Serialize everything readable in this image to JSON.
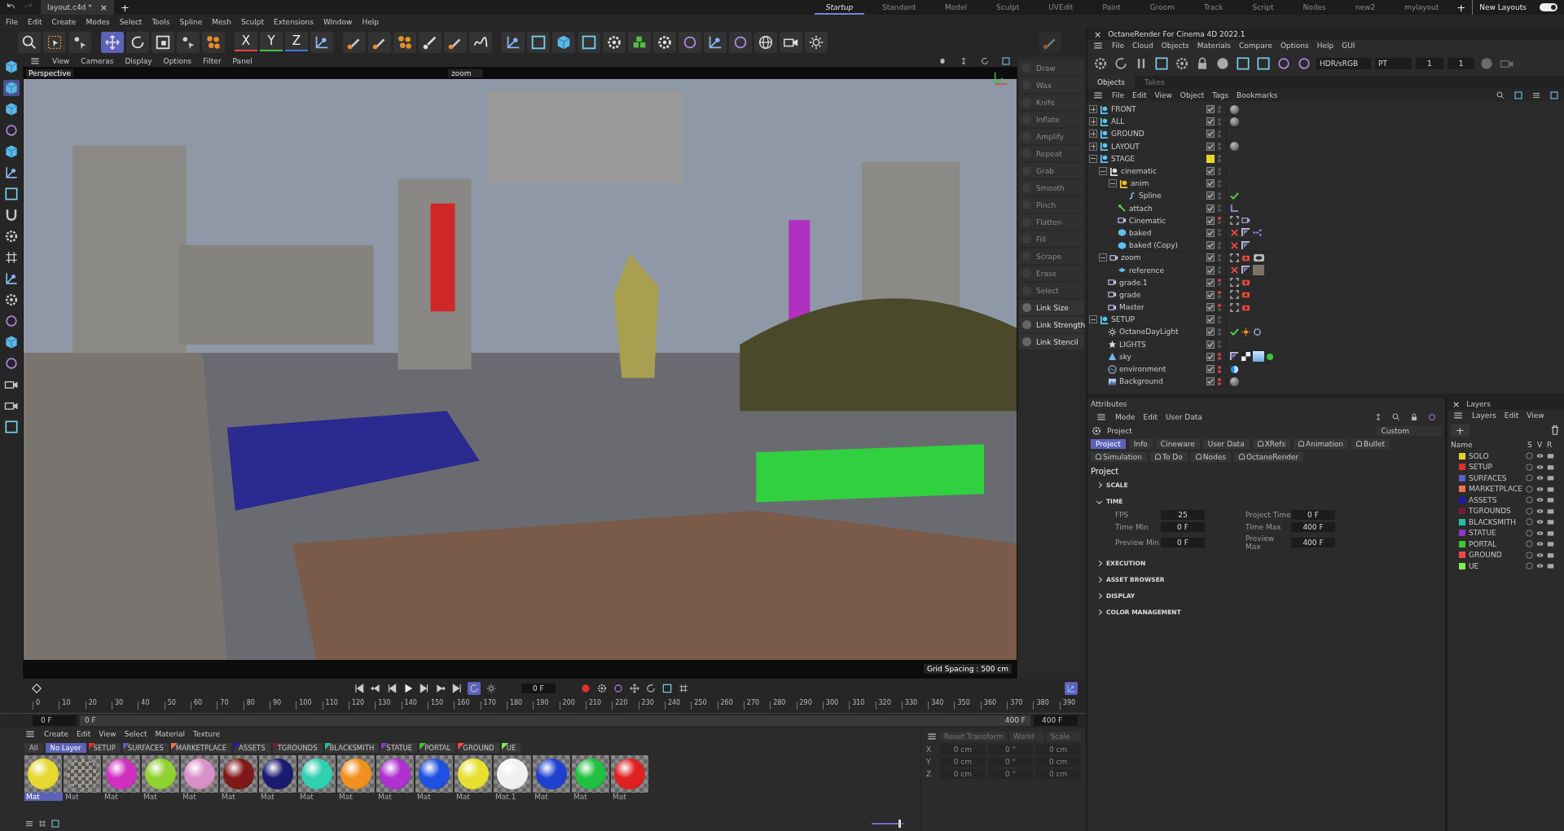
{
  "title_bar": {
    "file_tab": "layout.c4d *",
    "close": "×",
    "new_tab": "+",
    "workspaces": [
      {
        "label": "Startup",
        "selected": true
      },
      {
        "label": "Standard",
        "selected": false
      },
      {
        "label": "Model",
        "selected": false
      },
      {
        "label": "Sculpt",
        "selected": false
      },
      {
        "label": "UVEdit",
        "selected": false
      },
      {
        "label": "Paint",
        "selected": false
      },
      {
        "label": "Groom",
        "selected": false
      },
      {
        "label": "Track",
        "selected": false
      },
      {
        "label": "Script",
        "selected": false
      },
      {
        "label": "Nodes",
        "selected": false
      },
      {
        "label": "new2",
        "selected": false
      },
      {
        "label": "mylayout",
        "selected": false
      }
    ],
    "add_layout": "+",
    "new_layouts": {
      "label": "New Layouts",
      "on": true
    }
  },
  "menu_bar": [
    "File",
    "Edit",
    "Create",
    "Modes",
    "Select",
    "Tools",
    "Spline",
    "Mesh",
    "Sculpt",
    "Extensions",
    "Window",
    "Help"
  ],
  "axis_buttons": [
    {
      "label": "X",
      "color": "#e04848"
    },
    {
      "label": "Y",
      "color": "#48c048"
    },
    {
      "label": "Z",
      "color": "#4878e0"
    }
  ],
  "viewport": {
    "menu": [
      "View",
      "Cameras",
      "Display",
      "Options",
      "Filter",
      "Panel"
    ],
    "camera": "Perspective",
    "active_camera": "zoom",
    "grid_spacing": "Grid Spacing : 500 cm"
  },
  "sculpt_tools": [
    {
      "label": "Draw",
      "disabled": true
    },
    {
      "label": "Wax",
      "disabled": true
    },
    {
      "label": "Knife",
      "disabled": true
    },
    {
      "label": "Inflate",
      "disabled": true
    },
    {
      "label": "Amplify",
      "disabled": true
    },
    {
      "label": "Repeat",
      "disabled": true
    },
    {
      "label": "Grab",
      "disabled": true
    },
    {
      "label": "Smooth",
      "disabled": true
    },
    {
      "label": "Pinch",
      "disabled": true
    },
    {
      "label": "Flatten",
      "disabled": true
    },
    {
      "label": "Fill",
      "disabled": true
    },
    {
      "label": "Scrape",
      "disabled": true
    },
    {
      "label": "Erase",
      "disabled": true
    },
    {
      "label": "Select",
      "disabled": true
    },
    {
      "label": "Link Size",
      "disabled": false
    },
    {
      "label": "Link Strength",
      "disabled": false
    },
    {
      "label": "Link Stencil",
      "disabled": false
    }
  ],
  "octane": {
    "title": "OctaneRender For Cinema 4D 2022.1",
    "close": "×",
    "menu": [
      "File",
      "Cloud",
      "Objects",
      "Materials",
      "Compare",
      "Options",
      "Help",
      "GUI"
    ],
    "color_space": "HDR/sRGB",
    "kernel": "PT",
    "field_1": "1",
    "field_2": "1"
  },
  "objects": {
    "tabs": [
      {
        "label": "Objects",
        "selected": true
      },
      {
        "label": "Takes",
        "selected": false
      }
    ],
    "menu": [
      "File",
      "Edit",
      "View",
      "Object",
      "Tags",
      "Bookmarks"
    ],
    "tree": [
      {
        "name": "FRONT",
        "kind": "layer-null",
        "expanded": false,
        "enabled": true,
        "editor_off": false,
        "render_off": false,
        "tags": [
          {
            "kind": "material"
          }
        ]
      },
      {
        "name": "ALL",
        "kind": "layer-null",
        "expanded": false,
        "enabled": true,
        "editor_off": false,
        "render_off": false,
        "tags": [
          {
            "kind": "material"
          }
        ]
      },
      {
        "name": "GROUND",
        "kind": "layer-null",
        "expanded": false,
        "enabled": true,
        "editor_off": false,
        "render_off": false
      },
      {
        "name": "LAYOUT",
        "kind": "layer-null",
        "expanded": false,
        "enabled": true,
        "editor_off": false,
        "render_off": false,
        "tags": [
          {
            "kind": "material"
          }
        ]
      },
      {
        "name": "STAGE",
        "kind": "layer-null",
        "expanded": true,
        "color": "#e8d82a",
        "editor_off": false,
        "render_off": false,
        "children": [
          {
            "name": "cinematic",
            "kind": "null",
            "expanded": true,
            "enabled": true,
            "editor_off": false,
            "render_off": false,
            "children": [
              {
                "name": "anim",
                "kind": "null-yellow",
                "expanded": true,
                "enabled": true,
                "editor_off": false,
                "render_off": false,
                "children": [
                  {
                    "name": "Spline",
                    "kind": "spline",
                    "enabled": true,
                    "editor_off": false,
                    "render_off": false,
                    "tags": [
                      {
                        "kind": "check"
                      }
                    ]
                  }
                ]
              },
              {
                "name": "attach",
                "kind": "connector",
                "enabled": true,
                "editor_off": false,
                "render_off": false,
                "tags": [
                  {
                    "kind": "joint"
                  }
                ]
              },
              {
                "name": "Cinematic",
                "kind": "camera",
                "enabled": true,
                "editor_off": true,
                "render_off": false,
                "tags": [
                  {
                    "kind": "target"
                  },
                  {
                    "kind": "camera"
                  }
                ]
              },
              {
                "name": "baked",
                "kind": "cube",
                "enabled": true,
                "editor_off": false,
                "render_off": false,
                "tags": [
                  {
                    "kind": "cross"
                  },
                  {
                    "kind": "phong"
                  },
                  {
                    "kind": "dots"
                  }
                ]
              },
              {
                "name": "baked (Copy)",
                "kind": "cube",
                "enabled": true,
                "editor_off": false,
                "render_off": false,
                "tags": [
                  {
                    "kind": "cross"
                  },
                  {
                    "kind": "phong"
                  }
                ]
              }
            ]
          },
          {
            "name": "zoom",
            "kind": "camera",
            "expanded": true,
            "enabled": true,
            "editor_off": false,
            "render_off": false,
            "tags": [
              {
                "kind": "target"
              },
              {
                "kind": "record"
              },
              {
                "kind": "eye"
              }
            ],
            "children": [
              {
                "name": "reference",
                "kind": "plane",
                "enabled": true,
                "editor_off": false,
                "render_off": false,
                "tags": [
                  {
                    "kind": "cross"
                  },
                  {
                    "kind": "phong"
                  },
                  {
                    "kind": "texture"
                  }
                ]
              }
            ]
          },
          {
            "name": "grade.1",
            "kind": "camera",
            "enabled": true,
            "editor_off": true,
            "render_off": false,
            "tags": [
              {
                "kind": "target"
              },
              {
                "kind": "record"
              }
            ]
          },
          {
            "name": "grade",
            "kind": "camera",
            "enabled": true,
            "editor_off": true,
            "render_off": false,
            "tags": [
              {
                "kind": "target"
              },
              {
                "kind": "record"
              }
            ]
          },
          {
            "name": "Master",
            "kind": "camera",
            "enabled": true,
            "editor_off": true,
            "render_off": false,
            "tags": [
              {
                "kind": "target"
              },
              {
                "kind": "record"
              }
            ]
          }
        ]
      },
      {
        "name": "SETUP",
        "kind": "layer-null",
        "expanded": true,
        "enabled": true,
        "editor_off": false,
        "render_off": false,
        "children": [
          {
            "name": "OctaneDayLight",
            "kind": "light",
            "enabled": true,
            "editor_off": false,
            "render_off": false,
            "tags": [
              {
                "kind": "check"
              },
              {
                "kind": "sun"
              },
              {
                "kind": "gear"
              }
            ]
          },
          {
            "name": "LIGHTS",
            "kind": "star",
            "enabled": true,
            "editor_off": false,
            "render_off": false
          },
          {
            "name": "sky",
            "kind": "sky",
            "enabled": true,
            "editor_off": true,
            "render_off": true,
            "tags": [
              {
                "kind": "phong"
              },
              {
                "kind": "checker"
              },
              {
                "kind": "sky"
              },
              {
                "kind": "ball"
              }
            ]
          },
          {
            "name": "environment",
            "kind": "environment",
            "enabled": true,
            "editor_off": true,
            "render_off": true,
            "tags": [
              {
                "kind": "half"
              }
            ]
          },
          {
            "name": "Background",
            "kind": "background",
            "enabled": true,
            "editor_off": true,
            "render_off": true,
            "tags": [
              {
                "kind": "material"
              }
            ]
          }
        ]
      }
    ]
  },
  "attributes": {
    "tab": "Attributes",
    "menu": [
      "Mode",
      "Edit",
      "User Data"
    ],
    "object": "Project",
    "mode": "Custom",
    "tabs": [
      {
        "label": "Project",
        "selected": true,
        "icon": false
      },
      {
        "label": "Info",
        "selected": false,
        "icon": false
      },
      {
        "label": "Cineware",
        "selected": false,
        "icon": false
      },
      {
        "label": "User Data",
        "selected": false,
        "icon": false
      },
      {
        "label": "XRefs",
        "selected": false,
        "icon": true
      },
      {
        "label": "Animation",
        "selected": false,
        "icon": true
      },
      {
        "label": "Bullet",
        "selected": false,
        "icon": true
      },
      {
        "label": "Simulation",
        "selected": false,
        "icon": true
      },
      {
        "label": "To Do",
        "selected": false,
        "icon": true
      },
      {
        "label": "Nodes",
        "selected": false,
        "icon": true
      },
      {
        "label": "OctaneRender",
        "selected": false,
        "icon": true
      }
    ],
    "heading": "Project",
    "groups": [
      {
        "label": "SCALE",
        "expanded": false
      },
      {
        "label": "TIME",
        "expanded": true,
        "fields": [
          {
            "label": "FPS",
            "value": "25"
          },
          {
            "label": "Project Time",
            "value": "0 F"
          },
          {
            "label": "Time Min",
            "value": "0 F"
          },
          {
            "label": "Time Max",
            "value": "400 F"
          },
          {
            "label": "Preview Min",
            "value": "0 F"
          },
          {
            "label": "Preview Max",
            "value": "400 F"
          }
        ]
      },
      {
        "label": "EXECUTION",
        "expanded": false
      },
      {
        "label": "ASSET BROWSER",
        "expanded": false
      },
      {
        "label": "DISPLAY",
        "expanded": false
      },
      {
        "label": "COLOR MANAGEMENT",
        "expanded": false
      }
    ]
  },
  "layers": {
    "close": "×",
    "title": "Layers",
    "menu": [
      "Layers",
      "Edit",
      "View"
    ],
    "add": "+",
    "columns": [
      "Name",
      "S",
      "V",
      "R"
    ],
    "rows": [
      {
        "name": "SOLO",
        "color": "#e6d22a"
      },
      {
        "name": "SETUP",
        "color": "#e0302a"
      },
      {
        "name": "SURFACES",
        "color": "#5a5ec8"
      },
      {
        "name": "MARKETPLACE",
        "color": "#f07050"
      },
      {
        "name": "ASSETS",
        "color": "#1a1ab0"
      },
      {
        "name": "TGROUNDS",
        "color": "#7a1a3a"
      },
      {
        "name": "BLACKSMITH",
        "color": "#20c0a8"
      },
      {
        "name": "STATUE",
        "color": "#8a3ac8"
      },
      {
        "name": "PORTAL",
        "color": "#40c830"
      },
      {
        "name": "GROUND",
        "color": "#f04848"
      },
      {
        "name": "UE",
        "color": "#80f050"
      }
    ]
  },
  "timeline": {
    "frame": "0 F",
    "range": {
      "level": 1
    },
    "ruler": [
      "0",
      "10",
      "20",
      "30",
      "40",
      "50",
      "60",
      "70",
      "80",
      "90",
      "100",
      "110",
      "120",
      "130",
      "140",
      "150",
      "160",
      "170",
      "180",
      "190",
      "200",
      "210",
      "220",
      "230",
      "240",
      "250",
      "260",
      "270",
      "280",
      "290",
      "300",
      "310",
      "320",
      "330",
      "340",
      "350",
      "360",
      "370",
      "380",
      "390"
    ],
    "start": "0 F",
    "range_start": "0 F",
    "range_end": "400 F",
    "end": "400 F"
  },
  "materials": {
    "zoom": {
      "level": 0.9
    },
    "menu": [
      "Create",
      "Edit",
      "View",
      "Select",
      "Material",
      "Texture"
    ],
    "filters": [
      {
        "label": "All",
        "selected": false
      },
      {
        "label": "No Layer",
        "selected": true
      },
      {
        "label": "SETUP",
        "selected": false,
        "color": "#e0302a"
      },
      {
        "label": "SURFACES",
        "selected": false,
        "color": "#5a5ec8"
      },
      {
        "label": "MARKETPLACE",
        "selected": false,
        "color": "#f07050"
      },
      {
        "label": "ASSETS",
        "selected": false,
        "color": "#1a1ab0"
      },
      {
        "label": "TGROUNDS",
        "selected": false,
        "color": "#7a1a3a"
      },
      {
        "label": "BLACKSMITH",
        "selected": false,
        "color": "#20c0a8"
      },
      {
        "label": "STATUE",
        "selected": false,
        "color": "#8a3ac8"
      },
      {
        "label": "PORTAL",
        "selected": false,
        "color": "#40c830"
      },
      {
        "label": "GROUND",
        "selected": false,
        "color": "#f04848"
      },
      {
        "label": "UE",
        "selected": false,
        "color": "#80f050"
      }
    ],
    "items": [
      {
        "name": "Mat",
        "color": "#e6d830",
        "kind": "plain",
        "selected": true
      },
      {
        "name": "Mat",
        "color": "#a09a90",
        "kind": "texture",
        "selected": false
      },
      {
        "name": "Mat",
        "color": "#d030c0",
        "kind": "plain",
        "selected": false
      },
      {
        "name": "Mat",
        "color": "#90d030",
        "kind": "plain",
        "selected": false
      },
      {
        "name": "Mat",
        "color": "#d890c8",
        "kind": "plain",
        "selected": false
      },
      {
        "name": "Mat",
        "color": "#801818",
        "kind": "plain",
        "selected": false
      },
      {
        "name": "Mat",
        "color": "#1a1a70",
        "kind": "plain",
        "selected": false
      },
      {
        "name": "Mat",
        "color": "#30d0b0",
        "kind": "plain",
        "selected": false
      },
      {
        "name": "Mat",
        "color": "#f09020",
        "kind": "plain",
        "selected": false
      },
      {
        "name": "Mat",
        "color": "#b030d0",
        "kind": "plain",
        "selected": false
      },
      {
        "name": "Mat",
        "color": "#2050e0",
        "kind": "plain",
        "selected": false
      },
      {
        "name": "Mat",
        "color": "#e8e030",
        "kind": "plain",
        "selected": false
      },
      {
        "name": "Mat.1",
        "color": "#f0f0f0",
        "kind": "plain",
        "selected": false
      },
      {
        "name": "Mat",
        "color": "#2040d0",
        "kind": "plain",
        "selected": false
      },
      {
        "name": "Mat",
        "color": "#20c040",
        "kind": "plain",
        "selected": false
      },
      {
        "name": "Mat",
        "color": "#e02020",
        "kind": "plain",
        "selected": false
      }
    ]
  },
  "coordinates": {
    "transform": "Reset Transform",
    "space": "World",
    "mode": "Scale",
    "rows": [
      {
        "axis": "X",
        "position": "0 cm",
        "rotation": "0 °",
        "scale": "0 cm"
      },
      {
        "axis": "Y",
        "position": "0 cm",
        "rotation": "0 °",
        "scale": "0 cm"
      },
      {
        "axis": "Z",
        "position": "0 cm",
        "rotation": "0 °",
        "scale": "0 cm"
      }
    ]
  }
}
